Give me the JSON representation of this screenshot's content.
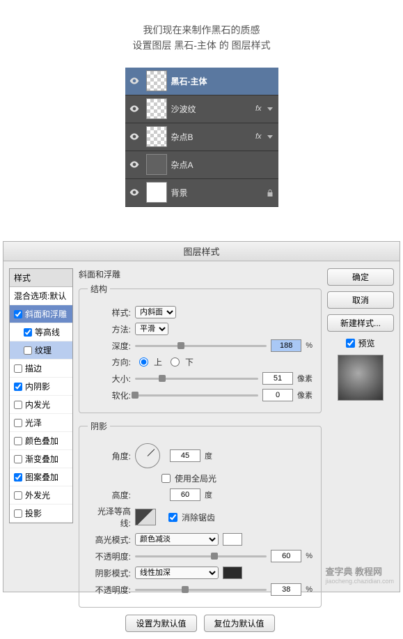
{
  "intro": {
    "line1": "我们现在来制作黑石的质感",
    "line2": "设置图层 黑石-主体 的 图层样式"
  },
  "layers": [
    {
      "name": "黑石-主体",
      "selected": true,
      "fx": false,
      "thumb": "checker",
      "locked": false
    },
    {
      "name": "沙波纹",
      "selected": false,
      "fx": true,
      "thumb": "checker",
      "locked": false
    },
    {
      "name": "杂点B",
      "selected": false,
      "fx": true,
      "thumb": "checker",
      "locked": false
    },
    {
      "name": "杂点A",
      "selected": false,
      "fx": false,
      "thumb": "noise",
      "locked": false
    },
    {
      "name": "背景",
      "selected": false,
      "fx": false,
      "thumb": "white",
      "locked": true
    }
  ],
  "dialog_title": "图层样式",
  "styles_header": "样式",
  "blend_options": "混合选项:默认",
  "style_items": [
    {
      "label": "斜面和浮雕",
      "checked": true,
      "active": true,
      "sub": false
    },
    {
      "label": "等高线",
      "checked": true,
      "active": false,
      "sub": true
    },
    {
      "label": "纹理",
      "checked": false,
      "active": false,
      "sub": true,
      "highlight": true
    },
    {
      "label": "描边",
      "checked": false,
      "active": false,
      "sub": false
    },
    {
      "label": "内阴影",
      "checked": true,
      "active": false,
      "sub": false
    },
    {
      "label": "内发光",
      "checked": false,
      "active": false,
      "sub": false
    },
    {
      "label": "光泽",
      "checked": false,
      "active": false,
      "sub": false
    },
    {
      "label": "颜色叠加",
      "checked": false,
      "active": false,
      "sub": false
    },
    {
      "label": "渐变叠加",
      "checked": false,
      "active": false,
      "sub": false
    },
    {
      "label": "图案叠加",
      "checked": true,
      "active": false,
      "sub": false
    },
    {
      "label": "外发光",
      "checked": false,
      "active": false,
      "sub": false
    },
    {
      "label": "投影",
      "checked": false,
      "active": false,
      "sub": false
    }
  ],
  "bevel": {
    "title": "斜面和浮雕",
    "structure_label": "结构",
    "style_label": "样式:",
    "style_value": "内斜面",
    "method_label": "方法:",
    "method_value": "平滑",
    "depth_label": "深度:",
    "depth_value": "188",
    "percent": "%",
    "direction_label": "方向:",
    "dir_up": "上",
    "dir_down": "下",
    "size_label": "大小:",
    "size_value": "51",
    "px": "像素",
    "soften_label": "软化:",
    "soften_value": "0"
  },
  "shadow": {
    "title": "阴影",
    "angle_label": "角度:",
    "angle_value": "45",
    "degree": "度",
    "global_light": "使用全局光",
    "altitude_label": "高度:",
    "altitude_value": "60",
    "gloss_contour_label": "光泽等高线:",
    "antialias": "消除锯齿",
    "highlight_mode_label": "高光模式:",
    "highlight_mode_value": "颜色减淡",
    "highlight_opacity_label": "不透明度:",
    "highlight_opacity_value": "60",
    "shadow_mode_label": "阴影模式:",
    "shadow_mode_value": "线性加深",
    "shadow_opacity_label": "不透明度:",
    "shadow_opacity_value": "38"
  },
  "bottom": {
    "default_set": "设置为默认值",
    "default_reset": "复位为默认值"
  },
  "right": {
    "ok": "确定",
    "cancel": "取消",
    "new_style": "新建样式...",
    "preview": "预览"
  },
  "watermark": {
    "main": "查字典 教程网",
    "sub": "jiaocheng.chazidian.com"
  }
}
